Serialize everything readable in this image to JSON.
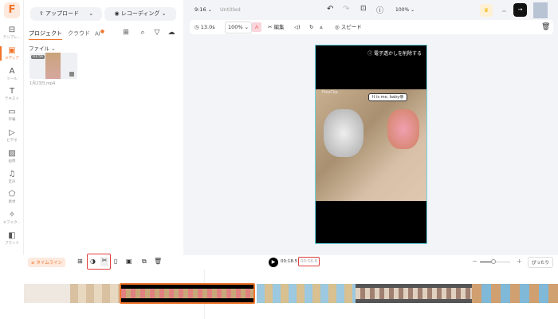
{
  "sidebar": {
    "logo": "F",
    "items": [
      {
        "label": "テンプレ…",
        "icon": "template-icon"
      },
      {
        "label": "メディア",
        "icon": "media-icon",
        "active": true
      },
      {
        "label": "ツール",
        "icon": "ai-tool-icon"
      },
      {
        "label": "テキスト",
        "icon": "text-icon"
      },
      {
        "label": "字幕",
        "icon": "subtitle-icon"
      },
      {
        "label": "ビデオ",
        "icon": "video-icon"
      },
      {
        "label": "画像",
        "icon": "image-icon"
      },
      {
        "label": "音声",
        "icon": "music-icon"
      },
      {
        "label": "素材",
        "icon": "element-icon"
      },
      {
        "label": "エフェク…",
        "icon": "effect-icon"
      },
      {
        "label": "ブランド",
        "icon": "brand-icon"
      }
    ]
  },
  "media": {
    "upload": "アップロード",
    "record": "レコーディング",
    "tabs": [
      "プロジェクト",
      "クラウド",
      "AI"
    ],
    "filter": "ファイル",
    "file": {
      "name": "1月23日.mp4",
      "duration": "01:56"
    }
  },
  "top": {
    "ratio": "9:16",
    "title": "Untitled",
    "zoom": "100%"
  },
  "toolbar": {
    "duration": "13.0s",
    "scale": "100%",
    "edit": "編集",
    "speed": "スピード"
  },
  "preview": {
    "watermark": "電子透かしを削除する",
    "caption": "It is me, baby😎",
    "brand": "FlexClip"
  },
  "timeline": {
    "label": "タイムライン",
    "current": "00:18.5",
    "total": "00:56.6",
    "fit": "ぴったり",
    "zoom_level": 0.45
  },
  "colors": {
    "accent": "#f0742a",
    "highlight": "#e04040",
    "selection": "#6fd3e0"
  }
}
